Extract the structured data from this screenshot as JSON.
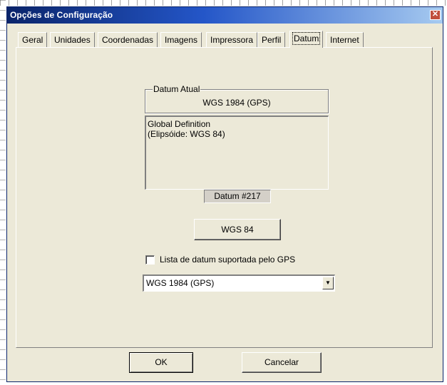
{
  "window": {
    "title": "Opções de Configuração",
    "close_glyph": "✕"
  },
  "tabs": [
    {
      "label": "Geral",
      "active": false
    },
    {
      "label": "Unidades",
      "active": false
    },
    {
      "label": "Coordenadas",
      "active": false
    },
    {
      "label": "Imagens",
      "active": false
    },
    {
      "label": "Impressora",
      "active": false
    },
    {
      "label": "Perfil",
      "active": false
    },
    {
      "label": "Datum",
      "active": true
    },
    {
      "label": "Internet",
      "active": false
    }
  ],
  "datum": {
    "group_label": "Datum Atual",
    "current": "WGS 1984 (GPS)",
    "definition_line1": "Global Definition",
    "definition_line2": "(Elipsóide: WGS 84)",
    "number": "Datum #217",
    "ellipsoid_button": "WGS 84",
    "gps_checkbox_label": "Lista de datum suportada pelo GPS",
    "gps_checkbox_checked": false,
    "selected_option": "WGS 1984 (GPS)"
  },
  "footer": {
    "ok_label": "OK",
    "cancel_label": "Cancelar"
  },
  "icons": {
    "close": "close-icon",
    "dropdown": "chevron-down-icon"
  },
  "colors": {
    "titlebar_start": "#0a246a",
    "titlebar_end": "#a6caf0",
    "dialog_bg": "#ece9d8"
  }
}
